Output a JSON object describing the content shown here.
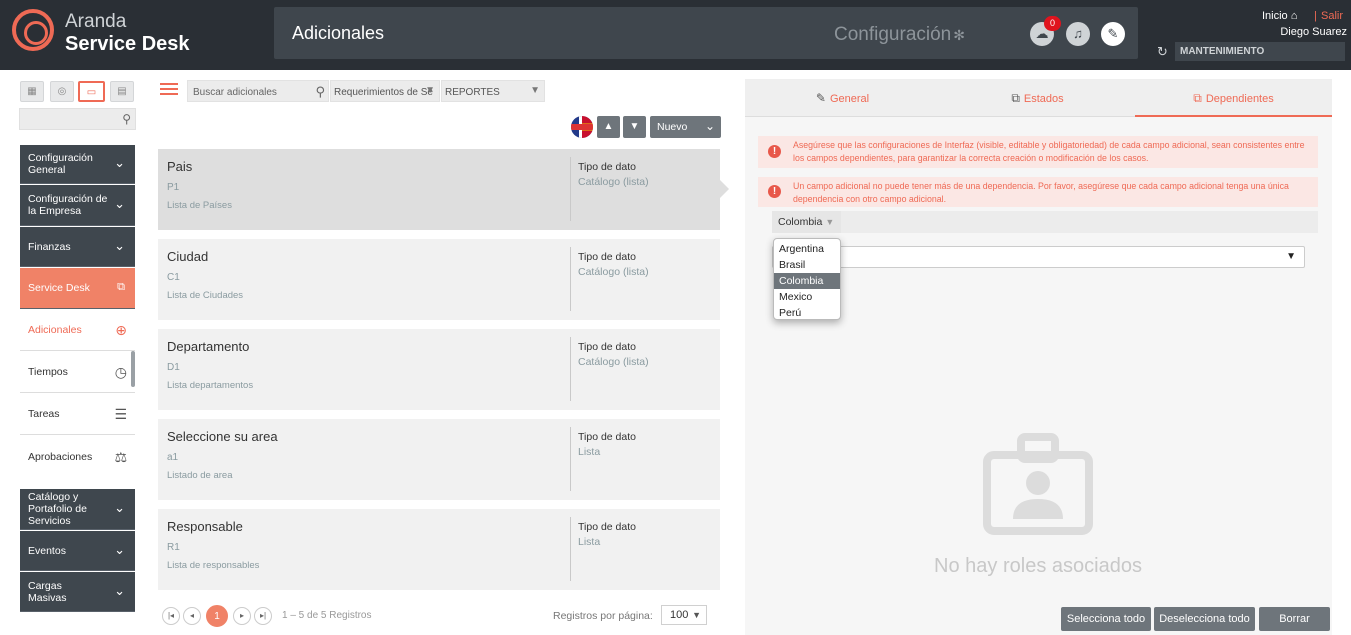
{
  "header": {
    "logo_line1": "Aranda",
    "logo_line2": "Service Desk",
    "page_title": "Adicionales",
    "config_label": "Configuración",
    "notification_count": "0",
    "inicio": "Inicio",
    "salir": "Salir",
    "separator": "|",
    "user_name": "Diego Suarez",
    "project": "MANTENIMIENTO"
  },
  "sidebar": {
    "search_placeholder": "",
    "menus": [
      {
        "label": "Configuración General"
      },
      {
        "label": "Configuración de la Empresa"
      },
      {
        "label": "Finanzas"
      },
      {
        "label": "Service Desk"
      }
    ],
    "subitems": [
      {
        "label": "Adicionales",
        "icon": "plus-circle-icon"
      },
      {
        "label": "Tiempos",
        "icon": "stopwatch-icon"
      },
      {
        "label": "Tareas",
        "icon": "tasks-icon"
      },
      {
        "label": "Aprobaciones",
        "icon": "stamp-icon"
      }
    ],
    "menus_bottom": [
      {
        "label": "Catálogo y Portafolio de Servicios"
      },
      {
        "label": "Eventos"
      },
      {
        "label": "Cargas Masivas"
      }
    ]
  },
  "toolbar": {
    "search_placeholder": "Buscar adicionales",
    "filter1": "Requerimientos de Se",
    "filter2": "REPORTES",
    "new_label": "Nuevo"
  },
  "list": {
    "type_label": "Tipo de dato",
    "items": [
      {
        "name": "Pais",
        "code": "P1",
        "desc": "Lista de Países",
        "type": "Catálogo (lista)"
      },
      {
        "name": "Ciudad",
        "code": "C1",
        "desc": "Lista de Ciudades",
        "type": "Catálogo (lista)"
      },
      {
        "name": "Departamento",
        "code": "D1",
        "desc": "Lista departamentos",
        "type": "Catálogo (lista)"
      },
      {
        "name": "Seleccione su area",
        "code": "a1",
        "desc": "Listado de area",
        "type": "Lista"
      },
      {
        "name": "Responsable",
        "code": "R1",
        "desc": "Lista de responsables",
        "type": "Lista"
      }
    ]
  },
  "pagination": {
    "current_page": "1",
    "info": "1 – 5 de 5 Registros",
    "per_page_label": "Registros por página:",
    "per_page_value": "100"
  },
  "detail": {
    "tabs": [
      {
        "label": "General"
      },
      {
        "label": "Estados"
      },
      {
        "label": "Dependientes"
      }
    ],
    "warnings": [
      "Asegúrese que las configuraciones de Interfaz (visible, editable y obligatoriedad) de cada campo adicional, sean consistentes entre los campos dependientes, para garantizar la correcta creación o modificación de los casos.",
      "Un campo adicional no puede tener más de una dependencia. Por favor, asegúrese que cada campo adicional tenga una única dependencia con otro campo adicional."
    ],
    "selected_country": "Colombia",
    "country_options": [
      "Argentina",
      "Brasil",
      "Colombia",
      "Mexico",
      "Perú"
    ],
    "empty_message": "No hay roles asociados",
    "buttons": {
      "select_all": "Selecciona todo",
      "deselect_all": "Deselecciona todo",
      "delete": "Borrar"
    }
  },
  "colors": {
    "accent": "#ef6a55",
    "header_bg": "#2a2f35",
    "menu_bg": "#3f474e"
  }
}
